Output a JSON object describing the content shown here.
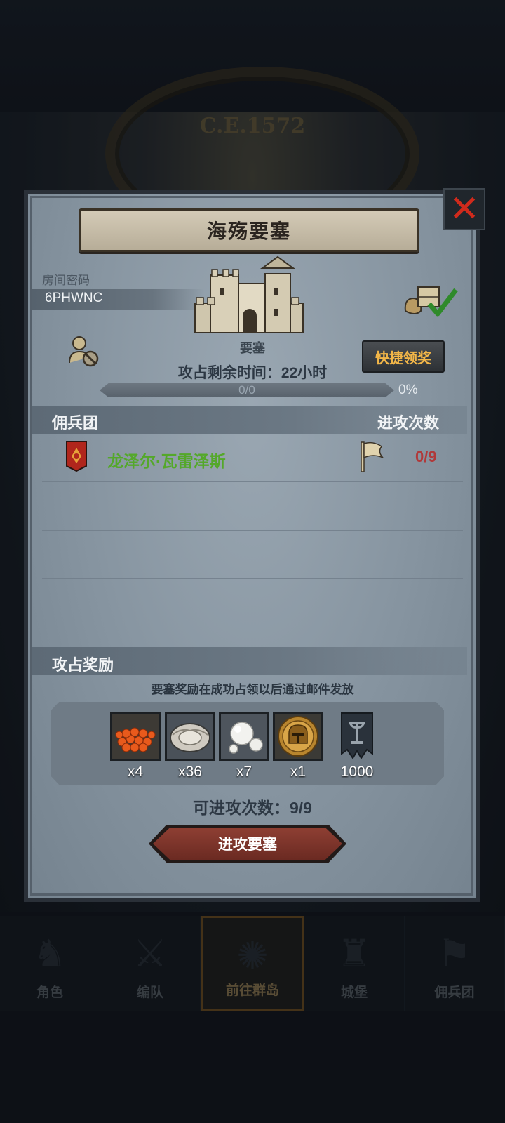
{
  "background": {
    "year_label": "C.E.1572"
  },
  "dialog": {
    "title": "海殇要塞",
    "room": {
      "label": "房间密码",
      "code": "6PHWNC"
    },
    "fortress": {
      "label": "要塞",
      "time_label": "攻占剩余时间：",
      "time_value": "22小时",
      "progress_text": "0/0",
      "progress_percent_text": "0%",
      "progress_fraction": 0
    },
    "quick_claim_label": "快捷领奖",
    "mercenary_section": {
      "title": "佣兵团",
      "attacks_header": "进攻次数",
      "rows": [
        {
          "name": "龙泽尔·瓦雷泽斯",
          "count": "0/9"
        }
      ]
    },
    "rewards_section": {
      "title": "攻占奖励",
      "note": "要塞奖励在成功占领以后通过邮件发放",
      "items": [
        {
          "icon": "caviar-icon",
          "qty": "x4"
        },
        {
          "icon": "oyster-icon",
          "qty": "x36"
        },
        {
          "icon": "pearl-icon",
          "qty": "x7"
        },
        {
          "icon": "knight-helmet-coin-icon",
          "qty": "x1"
        },
        {
          "icon": "mercenary-banner-icon",
          "qty": "1000"
        }
      ]
    },
    "attack_count_label": "可进攻次数：",
    "attack_count_value": "9/9",
    "attack_button_label": "进攻要塞"
  },
  "nav": {
    "items": [
      {
        "label": "角色",
        "icon": "character-icon"
      },
      {
        "label": "编队",
        "icon": "formation-icon"
      },
      {
        "label": "前往群岛",
        "icon": "compass-icon",
        "active": true
      },
      {
        "label": "城堡",
        "icon": "castle-icon"
      },
      {
        "label": "佣兵团",
        "icon": "mercenary-icon"
      }
    ]
  },
  "colors": {
    "merc_name": "#54a82a",
    "count_red": "#b0393a",
    "quick_btn_text": "#f2b648",
    "close_x": "#d02a1c",
    "attack_btn": "#8e3f33"
  }
}
